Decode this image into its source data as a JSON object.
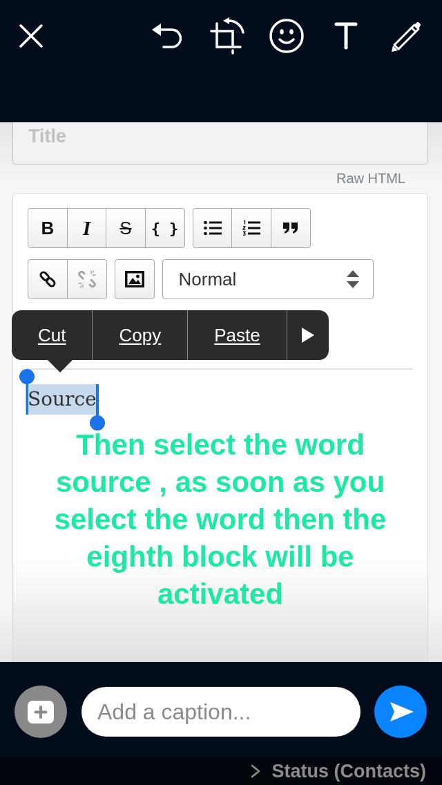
{
  "screenshot": {
    "title_field": {
      "placeholder": "Title"
    },
    "raw_html_link": "Raw HTML",
    "toolbar": {
      "rows": [
        {
          "groups": [
            {
              "buttons": [
                {
                  "kind": "bold",
                  "label": "B",
                  "disabled": false
                },
                {
                  "kind": "italic",
                  "label": "I",
                  "disabled": false
                },
                {
                  "kind": "strike",
                  "label": "S",
                  "disabled": false
                },
                {
                  "kind": "code",
                  "label": "{ }",
                  "disabled": false
                }
              ]
            },
            {
              "buttons": [
                {
                  "kind": "bullet_list",
                  "disabled": false
                },
                {
                  "kind": "numbered_list",
                  "disabled": false
                },
                {
                  "kind": "quote",
                  "disabled": false
                }
              ]
            }
          ]
        },
        {
          "groups": [
            {
              "buttons": [
                {
                  "kind": "link",
                  "disabled": false
                },
                {
                  "kind": "unlink",
                  "disabled": true
                }
              ]
            },
            {
              "buttons": [
                {
                  "kind": "image",
                  "disabled": false
                }
              ]
            }
          ],
          "style_select": {
            "value": "Normal"
          }
        }
      ]
    },
    "context_menu": {
      "items": [
        "Cut",
        "Copy",
        "Paste"
      ]
    },
    "content": {
      "text": "Source",
      "selected": true
    },
    "annotation": "Then select the word source , as soon as you select the word then the eighth block will be activated"
  },
  "caption_field": {
    "placeholder": "Add a caption..."
  },
  "status_bar": {
    "recipient": "Status (Contacts)"
  }
}
